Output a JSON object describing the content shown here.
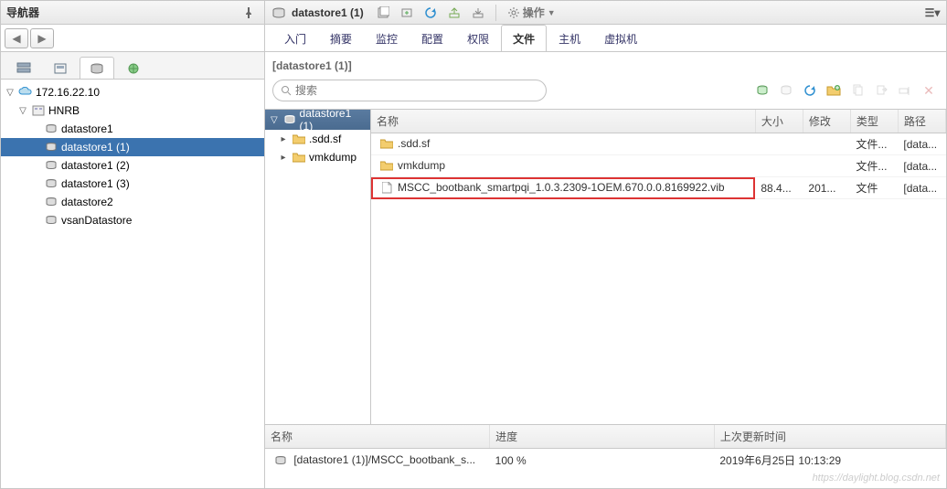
{
  "left": {
    "title": "导航器",
    "view_tabs": [
      {
        "icon": "tree-icon"
      },
      {
        "icon": "db-icon"
      },
      {
        "icon": "network-icon"
      }
    ],
    "tree": {
      "root_ip": "172.16.22.10",
      "datacenter": "HNRB",
      "datastores": [
        "datastore1",
        "datastore1 (1)",
        "datastore1 (2)",
        "datastore1 (3)",
        "datastore2",
        "vsanDatastore"
      ],
      "selected_index": 1
    }
  },
  "right": {
    "title": "datastore1 (1)",
    "actions_label": "操作",
    "tabs": [
      "入门",
      "摘要",
      "监控",
      "配置",
      "权限",
      "文件",
      "主机",
      "虚拟机"
    ],
    "active_tab_index": 5,
    "path": "[datastore1 (1)]",
    "search_placeholder": "搜索",
    "folder_tree": {
      "root": "datastore1 (1)",
      "folders": [
        ".sdd.sf",
        "vmkdump"
      ]
    },
    "file_table": {
      "headers": [
        "名称",
        "大小",
        "修改",
        "类型",
        "路径"
      ],
      "col_widths": [
        "404px",
        "50px",
        "50px",
        "50px",
        "50px"
      ],
      "rows": [
        {
          "name": ".sdd.sf",
          "size": "",
          "modified": "",
          "type": "文件...",
          "path": "[data...",
          "icon": "folder",
          "highlighted": false
        },
        {
          "name": "vmkdump",
          "size": "",
          "modified": "",
          "type": "文件...",
          "path": "[data...",
          "icon": "folder",
          "highlighted": false
        },
        {
          "name": "MSCC_bootbank_smartpqi_1.0.3.2309-1OEM.670.0.0.8169922.vib",
          "size": "88.4...",
          "modified": "201...",
          "type": "文件",
          "path": "[data...",
          "icon": "file",
          "highlighted": true
        }
      ]
    },
    "task_panel": {
      "headers": [
        "名称",
        "进度",
        "上次更新时间"
      ],
      "row": {
        "name": "[datastore1 (1)]/MSCC_bootbank_s...",
        "progress": "100 %",
        "updated": "2019年6月25日 10:13:29"
      }
    }
  },
  "watermark": "https://daylight.blog.csdn.net"
}
